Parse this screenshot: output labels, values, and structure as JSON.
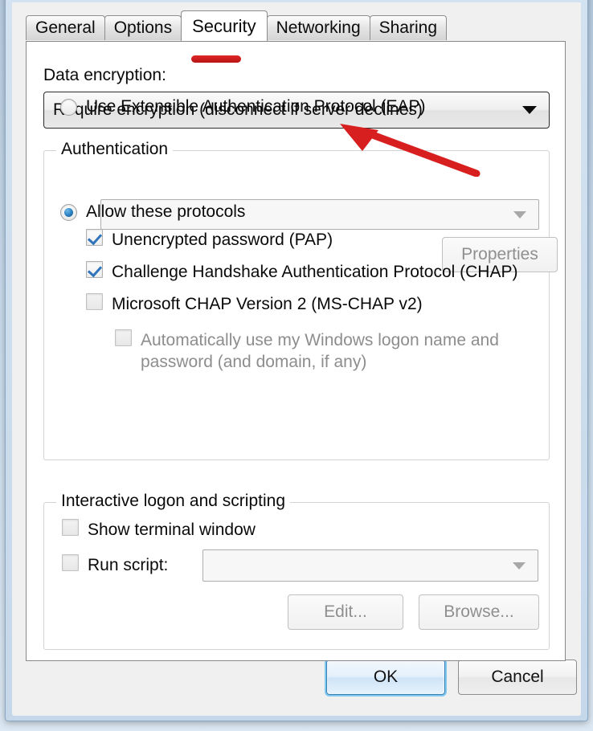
{
  "window": {
    "close_button": "close-button"
  },
  "tabs": [
    {
      "label": "General",
      "active": false
    },
    {
      "label": "Options",
      "active": false
    },
    {
      "label": "Security",
      "active": true
    },
    {
      "label": "Networking",
      "active": false
    },
    {
      "label": "Sharing",
      "active": false
    }
  ],
  "security": {
    "data_encryption_label": "Data encryption:",
    "data_encryption_value": "Require encryption (disconnect if server declines)",
    "authentication": {
      "group_title": "Authentication",
      "eap_radio_label": "Use Extensible Authentication Protocol (EAP)",
      "eap_radio_selected": false,
      "eap_combo_value": "",
      "eap_combo_enabled": false,
      "properties_button": "Properties",
      "properties_enabled": false,
      "allow_protocols_label": "Allow these protocols",
      "allow_protocols_selected": true,
      "protocols": [
        {
          "label": "Unencrypted password (PAP)",
          "checked": true,
          "enabled": true
        },
        {
          "label": "Challenge Handshake Authentication Protocol (CHAP)",
          "checked": true,
          "enabled": true
        },
        {
          "label": "Microsoft CHAP Version 2 (MS-CHAP v2)",
          "checked": false,
          "enabled": true
        }
      ],
      "auto_logon_label": "Automatically use my Windows logon name and password (and domain, if any)",
      "auto_logon_checked": false,
      "auto_logon_enabled": false
    },
    "interactive": {
      "group_title": "Interactive logon and scripting",
      "show_terminal_label": "Show terminal window",
      "show_terminal_checked": false,
      "run_script_label": "Run script:",
      "run_script_checked": false,
      "run_script_value": "",
      "edit_button": "Edit...",
      "edit_enabled": false,
      "browse_button": "Browse...",
      "browse_enabled": false
    }
  },
  "footer": {
    "ok_button": "OK",
    "cancel_button": "Cancel"
  },
  "annotations": {
    "underline_color": "#c81818",
    "arrow_color": "#d81f1f",
    "arrow_target": "data-encryption-combo"
  }
}
